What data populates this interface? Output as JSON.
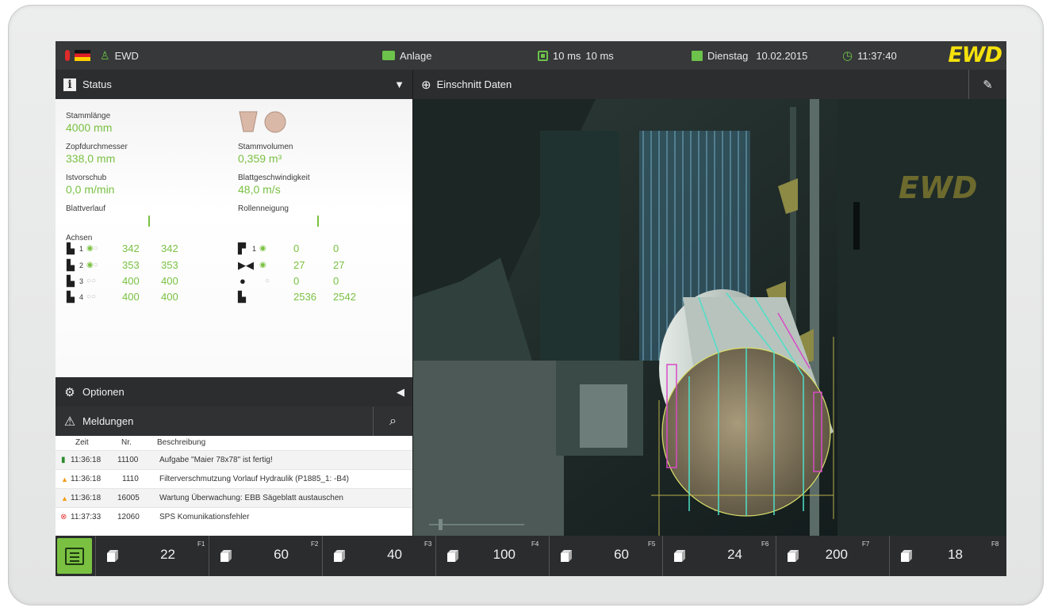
{
  "topbar": {
    "user": "EWD",
    "plant": "Anlage",
    "cycle1": "10 ms",
    "cycle2": "10 ms",
    "weekday": "Dienstag",
    "date": "10.02.2015",
    "time": "11:37:40",
    "logo": "EWD"
  },
  "status": {
    "title": "Status",
    "stammlaenge_label": "Stammlänge",
    "stammlaenge_value": "4000 mm",
    "zopf_label": "Zopfdurchmesser",
    "zopf_value": "338,0 mm",
    "stammvol_label": "Stammvolumen",
    "stammvol_value": "0,359 m³",
    "ist_label": "Istvorschub",
    "ist_value": "0,0 m/min",
    "blattgeschw_label": "Blattgeschwindigkeit",
    "blattgeschw_value": "48,0 m/s",
    "blattverlauf_label": "Blattverlauf",
    "rollen_label": "Rollenneigung",
    "achsen_label": "Achsen",
    "axes_left": [
      {
        "n": "1",
        "a": "342",
        "b": "342"
      },
      {
        "n": "2",
        "a": "353",
        "b": "353"
      },
      {
        "n": "3",
        "a": "400",
        "b": "400"
      },
      {
        "n": "4",
        "a": "400",
        "b": "400"
      }
    ],
    "axes_right": [
      {
        "n": "1",
        "a": "0",
        "b": "0"
      },
      {
        "n": "",
        "a": "27",
        "b": "27"
      },
      {
        "n": "",
        "a": "0",
        "b": "0"
      },
      {
        "n": "",
        "a": "2536",
        "b": "2542"
      }
    ]
  },
  "optionen": {
    "title": "Optionen"
  },
  "meldungen": {
    "title": "Meldungen",
    "columns": {
      "zeit": "Zeit",
      "nr": "Nr.",
      "beschreibung": "Beschreibung"
    },
    "rows": [
      {
        "zeit": "11:36:18",
        "nr": "11100",
        "text": "Aufgabe \"Maier 78x78\" ist fertig!",
        "type": "info"
      },
      {
        "zeit": "11:36:18",
        "nr": "1110",
        "text": "Filterverschmutzung Vorlauf Hydraulik (P1885_1: -B4)",
        "type": "warning"
      },
      {
        "zeit": "11:36:18",
        "nr": "16005",
        "text": "Wartung Überwachung: EBB Sägeblatt austauschen",
        "type": "warning"
      },
      {
        "zeit": "11:37:33",
        "nr": "12060",
        "text": "SPS Komunikationsfehler",
        "type": "error"
      }
    ]
  },
  "einschnitt": {
    "title": "Einschnitt Daten",
    "logo": "EWD"
  },
  "fkeys": [
    {
      "value": "22",
      "key": "F1"
    },
    {
      "value": "60",
      "key": "F2"
    },
    {
      "value": "40",
      "key": "F3"
    },
    {
      "value": "100",
      "key": "F4"
    },
    {
      "value": "60",
      "key": "F5"
    },
    {
      "value": "24",
      "key": "F6"
    },
    {
      "value": "200",
      "key": "F7"
    },
    {
      "value": "18",
      "key": "F8"
    }
  ],
  "colors": {
    "accent": "#7ac142",
    "logo": "#f5e10c",
    "warning": "#f39c12",
    "error": "#e53935"
  }
}
